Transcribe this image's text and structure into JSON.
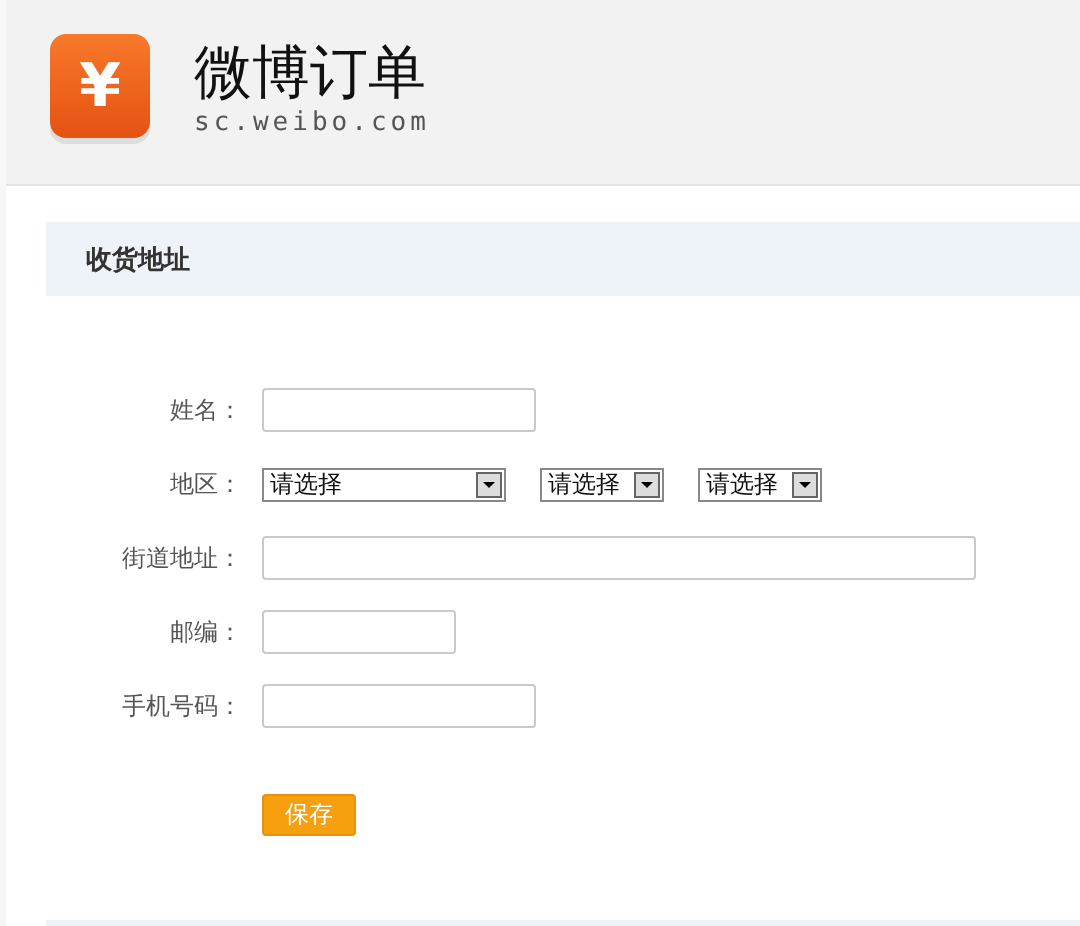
{
  "header": {
    "title": "微博订单",
    "subtitle": "sc.weibo.com",
    "logo_symbol": "¥"
  },
  "section": {
    "title": "收货地址"
  },
  "form": {
    "fields": [
      {
        "kind": "input",
        "label": "姓名："
      },
      {
        "kind": "selects",
        "label": "地区：",
        "selects": [
          {
            "value": "请选择"
          },
          {
            "value": "请选择"
          },
          {
            "value": "请选择"
          }
        ]
      },
      {
        "kind": "input",
        "label": "街道地址："
      },
      {
        "kind": "input",
        "label": "邮编："
      },
      {
        "kind": "input",
        "label": "手机号码："
      }
    ],
    "submit": "保存"
  }
}
